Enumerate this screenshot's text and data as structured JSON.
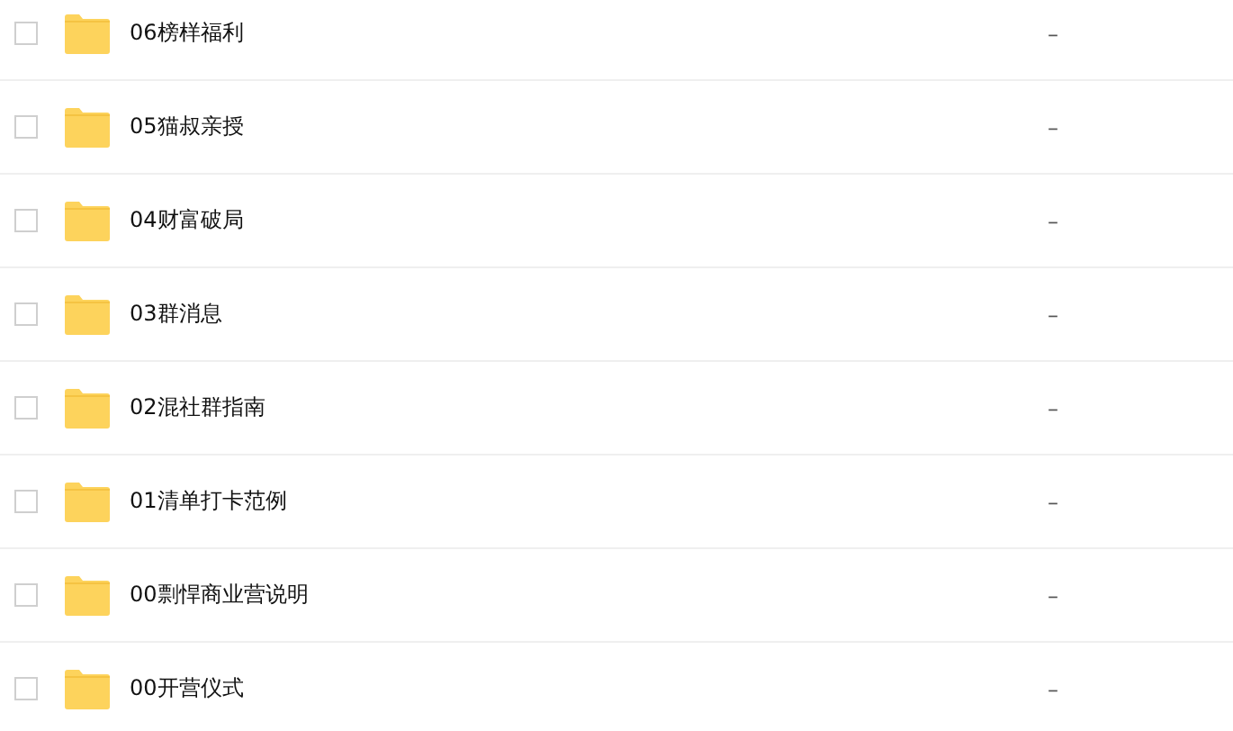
{
  "files": [
    {
      "name": "06榜样福利",
      "checked": false,
      "size": "–"
    },
    {
      "name": "05猫叔亲授",
      "checked": false,
      "size": "–"
    },
    {
      "name": "04财富破局",
      "checked": false,
      "size": "–"
    },
    {
      "name": "03群消息",
      "checked": false,
      "size": "–"
    },
    {
      "name": "02混社群指南",
      "checked": false,
      "size": "–"
    },
    {
      "name": "01清单打卡范例",
      "checked": false,
      "size": "–"
    },
    {
      "name": "00剽悍商业营说明",
      "checked": false,
      "size": "–"
    },
    {
      "name": "00开营仪式",
      "checked": false,
      "size": "–"
    }
  ]
}
